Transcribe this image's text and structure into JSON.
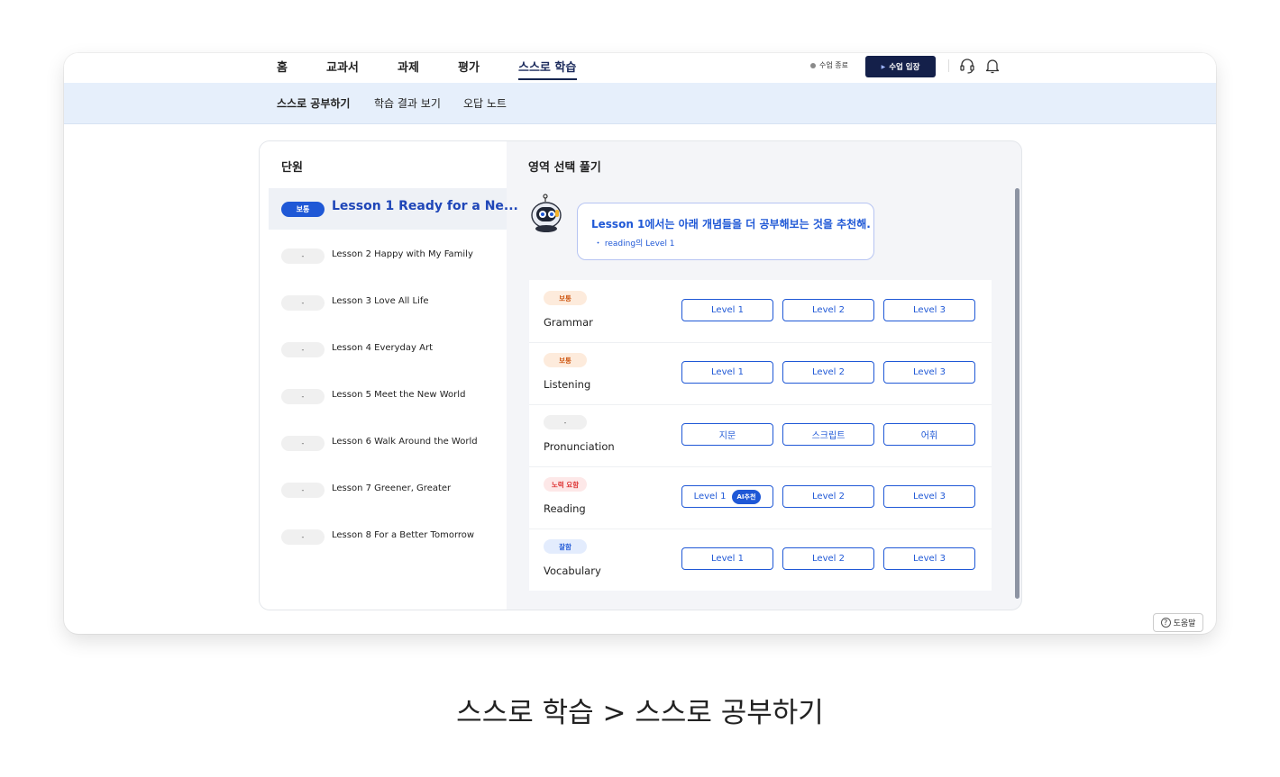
{
  "nav": {
    "items": [
      {
        "label": "홈",
        "active": false
      },
      {
        "label": "교과서",
        "active": false
      },
      {
        "label": "과제",
        "active": false
      },
      {
        "label": "평가",
        "active": false
      },
      {
        "label": "스스로 학습",
        "active": true
      }
    ],
    "status_label": "수업 종료",
    "enter_label": "수업 입장",
    "icons": [
      "headset-icon",
      "bell-icon"
    ]
  },
  "subnav": {
    "items": [
      {
        "label": "스스로 공부하기",
        "active": true
      },
      {
        "label": "학습 결과 보기",
        "active": false
      },
      {
        "label": "오답 노트",
        "active": false
      }
    ]
  },
  "lessons_panel": {
    "title": "단원",
    "items": [
      {
        "badge": "보통",
        "title": "Lesson 1 Ready for a Ne...",
        "selected": true
      },
      {
        "badge": "-",
        "title": "Lesson 2 Happy with My Family",
        "selected": false
      },
      {
        "badge": "-",
        "title": "Lesson 3 Love All Life",
        "selected": false
      },
      {
        "badge": "-",
        "title": "Lesson 4 Everyday Art",
        "selected": false
      },
      {
        "badge": "-",
        "title": "Lesson 5 Meet the New World",
        "selected": false
      },
      {
        "badge": "-",
        "title": "Lesson 6 Walk Around the World",
        "selected": false
      },
      {
        "badge": "-",
        "title": "Lesson 7 Greener, Greater",
        "selected": false
      },
      {
        "badge": "-",
        "title": "Lesson 8 For a Better Tomorrow",
        "selected": false
      }
    ]
  },
  "area_panel": {
    "title": "영역 선택 풀기",
    "recommendation": {
      "title": "Lesson 1에서는 아래 개념들을 더 공부해보는 것을 추천해.",
      "item": "・ reading의 Level 1"
    },
    "areas": [
      {
        "name": "Grammar",
        "status": "보통",
        "status_color": "#cf5a17",
        "buttons": [
          "Level 1",
          "Level 2",
          "Level 3"
        ]
      },
      {
        "name": "Listening",
        "status": "보통",
        "status_color": "#cf5a17",
        "buttons": [
          "Level 1",
          "Level 2",
          "Level 3"
        ]
      },
      {
        "name": "Pronunciation",
        "status": "-",
        "status_color": "#555555",
        "buttons": [
          "지문",
          "스크립트",
          "어휘"
        ]
      },
      {
        "name": "Reading",
        "status": "노력 요함",
        "status_color": "#dd3333",
        "buttons": [
          "Level 1",
          "Level 2",
          "Level 3"
        ],
        "ai_tag": "AI추천"
      },
      {
        "name": "Vocabulary",
        "status": "잘함",
        "status_color": "#1f58d6",
        "buttons": [
          "Level 1",
          "Level 2",
          "Level 3"
        ]
      }
    ]
  },
  "help_label": "도움말",
  "caption": "스스로 학습 > 스스로 공부하기",
  "colors": {
    "primary": "#1f58d6",
    "navy": "#14204a",
    "subnav_bg": "#e6effb"
  }
}
